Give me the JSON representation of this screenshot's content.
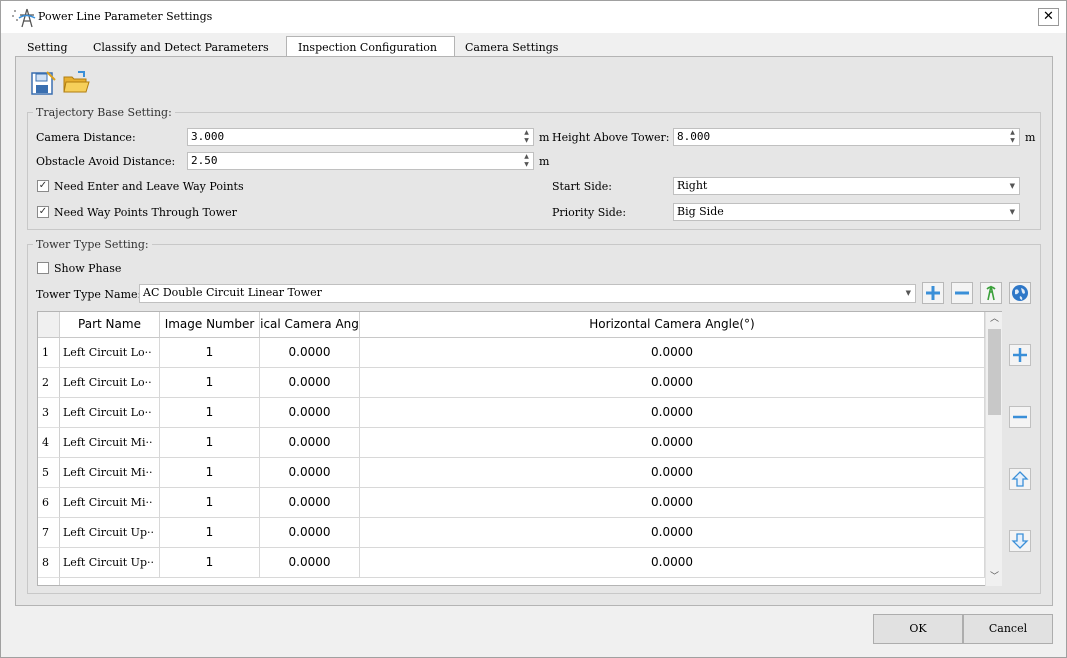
{
  "window": {
    "title": "Power Line Parameter Settings"
  },
  "tabs": [
    {
      "label": "Setting"
    },
    {
      "label": "Classify and Detect Parameters"
    },
    {
      "label": "Inspection Configuration"
    },
    {
      "label": "Camera Settings"
    }
  ],
  "active_tab": "Inspection Configuration",
  "toolbar": {
    "save_icon": "save-icon",
    "open_icon": "open-folder-icon"
  },
  "trajectory": {
    "title": "Trajectory Base Setting:",
    "camera_distance": {
      "label": "Camera Distance:",
      "value": "3.000",
      "unit": "m"
    },
    "height_above_tower": {
      "label": "Height Above Tower:",
      "value": "8.000",
      "unit": "m"
    },
    "obstacle_avoid_distance": {
      "label": "Obstacle Avoid Distance:",
      "value": "2.50",
      "unit": "m"
    },
    "need_enter_leave": {
      "label": "Need Enter and Leave Way Points",
      "checked": true
    },
    "need_through_tower": {
      "label": "Need Way Points Through Tower",
      "checked": true
    },
    "start_side": {
      "label": "Start Side:",
      "value": "Right"
    },
    "priority_side": {
      "label": "Priority Side:",
      "value": "Big Side"
    }
  },
  "tower": {
    "title": "Tower Type Setting:",
    "show_phase": {
      "label": "Show Phase",
      "checked": false
    },
    "tower_type_name": {
      "label": "Tower Type Name:",
      "value": "AC Double Circuit Linear Tower"
    }
  },
  "table": {
    "columns": [
      "Part Name",
      "Image Number",
      "ical Camera Ang",
      "Horizontal Camera Angle(°)"
    ],
    "rows": [
      {
        "index": "1",
        "part": "Left Circuit Lo··",
        "images": "1",
        "vertical": "0.0000",
        "horizontal": "0.0000"
      },
      {
        "index": "2",
        "part": "Left Circuit Lo··",
        "images": "1",
        "vertical": "0.0000",
        "horizontal": "0.0000"
      },
      {
        "index": "3",
        "part": "Left Circuit Lo··",
        "images": "1",
        "vertical": "0.0000",
        "horizontal": "0.0000"
      },
      {
        "index": "4",
        "part": "Left Circuit Mi··",
        "images": "1",
        "vertical": "0.0000",
        "horizontal": "0.0000"
      },
      {
        "index": "5",
        "part": "Left Circuit Mi··",
        "images": "1",
        "vertical": "0.0000",
        "horizontal": "0.0000"
      },
      {
        "index": "6",
        "part": "Left Circuit Mi··",
        "images": "1",
        "vertical": "0.0000",
        "horizontal": "0.0000"
      },
      {
        "index": "7",
        "part": "Left Circuit Up··",
        "images": "1",
        "vertical": "0.0000",
        "horizontal": "0.0000"
      },
      {
        "index": "8",
        "part": "Left Circuit Up··",
        "images": "1",
        "vertical": "0.0000",
        "horizontal": "0.0000"
      }
    ]
  },
  "buttons": {
    "ok": "OK",
    "cancel": "Cancel"
  },
  "colors": {
    "add_blue": "#3a8fd8",
    "remove_blue": "#3a8fd8",
    "green": "#3aa03a",
    "window_bg": "#f0f0f0",
    "pane_bg": "#e6e6e6"
  }
}
